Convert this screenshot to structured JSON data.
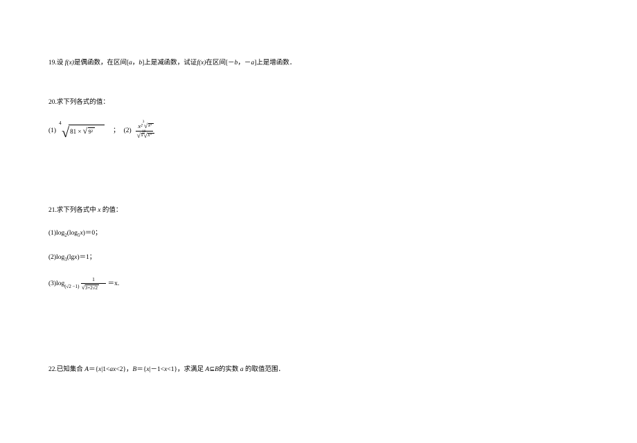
{
  "q19": {
    "number": "19.设 ",
    "fx": "f(x)",
    "part1": "是偶函数，在区间[",
    "a": "a",
    "comma1": "，",
    "b": "b",
    "part2": "]上是减函数，试证",
    "fx2": "f(x)",
    "part3": "在区间[－",
    "b2": "b",
    "comma2": "，－",
    "a2": "a",
    "part4": "]上是增函数．"
  },
  "q20": {
    "number": "20.求下列各式的值：",
    "sub1_label": "(1)",
    "radical1": {
      "degree": "4",
      "radicand_left": "81 × ",
      "inner_radicand": "9²"
    },
    "semicolon": "；",
    "sub2_label": "(2)",
    "frac": {
      "num_x2": "x²",
      "num_cbrt": "x³",
      "den_sqrt": "x",
      "den_10rt": "x³",
      "den_10deg": "10"
    }
  },
  "q21": {
    "number": "21.求下列各式中",
    "x_var": " x ",
    "tail": "的值：",
    "sub1": {
      "label": "(1)log",
      "base": "2",
      "left": "(log",
      "inner_base": "5",
      "inner_arg": "x",
      "right": ")＝0；"
    },
    "sub2": {
      "label": "(2)log",
      "base": "3",
      "left": "(lg",
      "arg": "x",
      "right": ")＝1；"
    },
    "sub3": {
      "label": "(3)log",
      "base_open": "(√2 −1)",
      "frac_num": "1",
      "frac_den_sqrt": "3+2√2",
      "equals_x": "＝x."
    }
  },
  "q22": {
    "number": "22.已知集合 ",
    "A": "A",
    "eq1": "＝{",
    "x1": "x",
    "bar1": "|1<",
    "ax": "ax",
    "lt2": "<2}，",
    "B": "B",
    "eq2": "＝{",
    "x2": "x",
    "bar2": "|－1<",
    "x3": "x",
    "lt1": "<1}，求满足 ",
    "A2": "A",
    "subset": "⊆",
    "B2": "B",
    "tail": "的实数 ",
    "a": "a",
    "end": " 的取值范围．"
  }
}
